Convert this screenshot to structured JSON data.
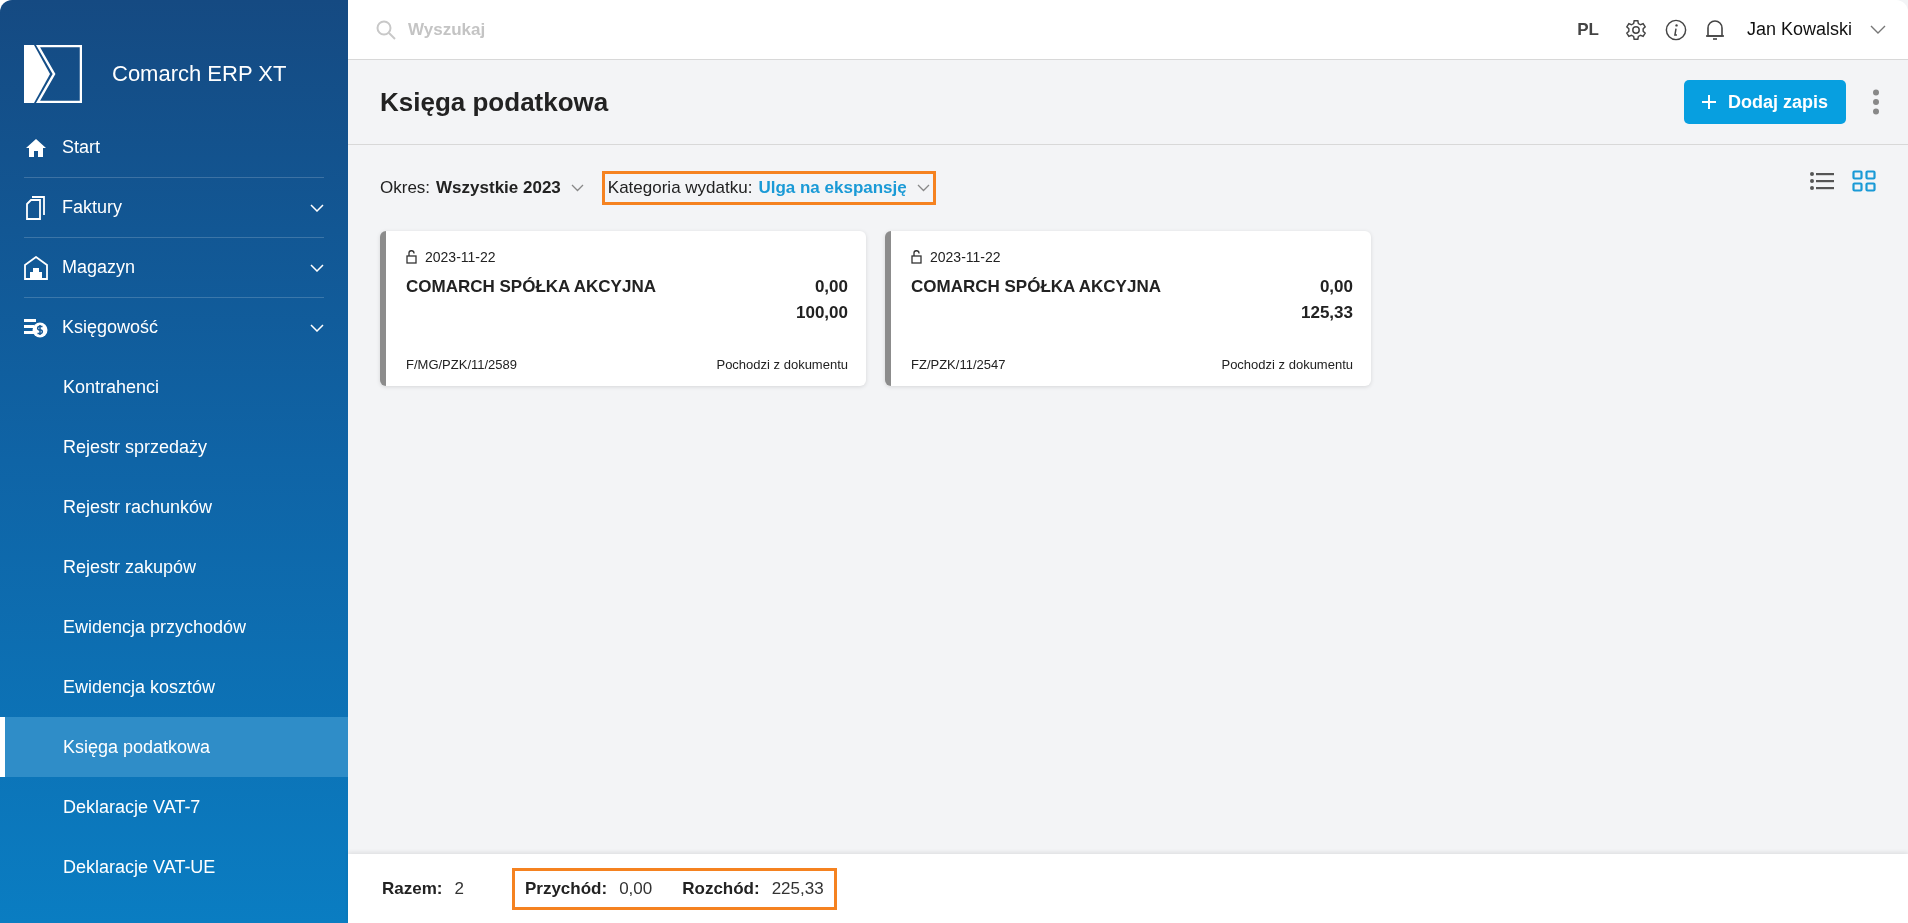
{
  "app": {
    "name": "Comarch ERP XT"
  },
  "sidebar": {
    "items": [
      {
        "label": "Start",
        "expandable": false,
        "selected": false
      },
      {
        "label": "Faktury",
        "expandable": true,
        "selected": false
      },
      {
        "label": "Magazyn",
        "expandable": true,
        "selected": false
      },
      {
        "label": "Księgowość",
        "expandable": true,
        "selected": false,
        "children": [
          {
            "label": "Kontrahenci",
            "selected": false
          },
          {
            "label": "Rejestr sprzedaży",
            "selected": false
          },
          {
            "label": "Rejestr rachunków",
            "selected": false
          },
          {
            "label": "Rejestr zakupów",
            "selected": false
          },
          {
            "label": "Ewidencja przychodów",
            "selected": false
          },
          {
            "label": "Ewidencja kosztów",
            "selected": false
          },
          {
            "label": "Księga podatkowa",
            "selected": true
          },
          {
            "label": "Deklaracje VAT-7",
            "selected": false
          },
          {
            "label": "Deklaracje VAT-UE",
            "selected": false
          }
        ]
      }
    ]
  },
  "topbar": {
    "search": {
      "placeholder": "Wyszukaj"
    },
    "language": "PL",
    "user": "Jan Kowalski"
  },
  "page": {
    "title": "Księga podatkowa",
    "add_button": "Dodaj zapis"
  },
  "filters": [
    {
      "label": "Okres:",
      "value": "Wszystkie 2023",
      "highlighted": false,
      "color": "#222222"
    },
    {
      "label": "Kategoria wydatku:",
      "value": "Ulga na ekspansję",
      "highlighted": true,
      "color": "#1a9ad6"
    }
  ],
  "view_toggle": [
    {
      "kind": "list",
      "selected": false
    },
    {
      "kind": "grid",
      "selected": true
    }
  ],
  "cards": [
    {
      "date": "2023-11-22",
      "locked": false,
      "contractor": "COMARCH SPÓŁKA AKCYJNA",
      "amounts": [
        "0,00",
        "100,00"
      ],
      "document": "F/MG/PZK/11/2589",
      "source": "Pochodzi z dokumentu"
    },
    {
      "date": "2023-11-22",
      "locked": false,
      "contractor": "COMARCH SPÓŁKA AKCYJNA",
      "amounts": [
        "0,00",
        "125,33"
      ],
      "document": "FZ/PZK/11/2547",
      "source": "Pochodzi z dokumentu"
    }
  ],
  "footer": {
    "groups": [
      {
        "highlighted": false,
        "items": [
          {
            "label": "Razem:",
            "value": "2"
          }
        ]
      },
      {
        "highlighted": true,
        "items": [
          {
            "label": "Przychód:",
            "value": "0,00"
          },
          {
            "label": "Rozchód:",
            "value": "225,33"
          }
        ]
      }
    ]
  }
}
